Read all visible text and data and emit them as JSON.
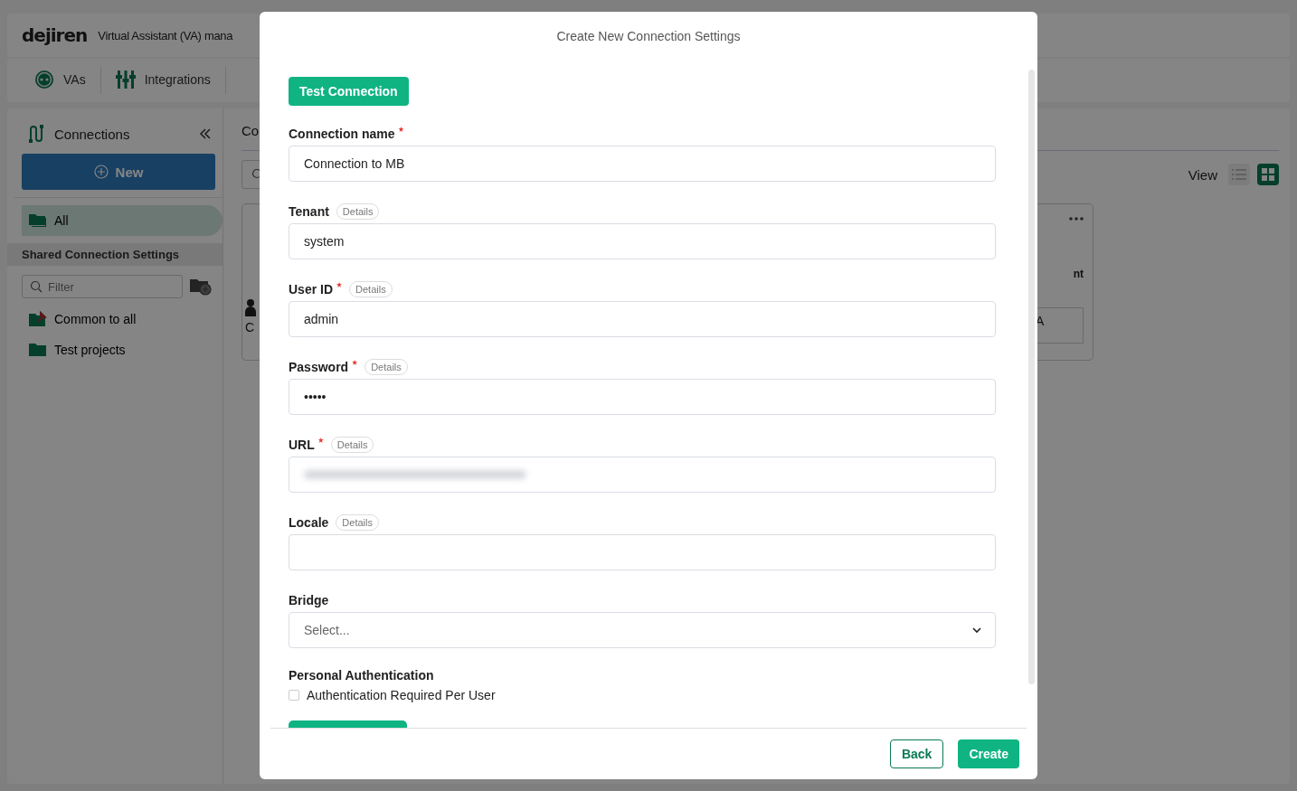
{
  "app": {
    "logo": "dejiren",
    "title": "Virtual Assistant (VA) mana",
    "tabs": [
      {
        "label": "VAs",
        "kind": "vas",
        "selected": false
      },
      {
        "label": "Integrations",
        "kind": "integrations",
        "selected": false
      }
    ],
    "sidebar": {
      "title": "Connections",
      "new_button": "New",
      "items": [
        {
          "label": "All",
          "selected": true
        }
      ],
      "section": "Shared Connection Settings",
      "filter_placeholder": "Filter",
      "folders": [
        {
          "label": "Common to all",
          "kind": "pinned"
        },
        {
          "label": "Test projects",
          "kind": "folder"
        }
      ]
    },
    "content": {
      "heading": "Co",
      "view_label": "View",
      "view_modes": [
        {
          "kind": "list",
          "selected": false
        },
        {
          "kind": "grid",
          "selected": true
        }
      ],
      "card": {
        "left_text": "C",
        "right_text": "nt",
        "right_box_text": "A"
      }
    }
  },
  "dialog": {
    "title": "Create New Connection Settings",
    "test_button": "Test Connection",
    "fields": [
      {
        "label": "Connection name",
        "required": true,
        "kind": "text",
        "value": "Connection to MB"
      },
      {
        "label": "Tenant",
        "required": false,
        "details": "Details",
        "kind": "text",
        "value": "system"
      },
      {
        "label": "User ID",
        "required": true,
        "details": "Details",
        "kind": "text",
        "value": "admin"
      },
      {
        "label": "Password",
        "required": true,
        "details": "Details",
        "kind": "text",
        "value": "•••••"
      },
      {
        "label": "URL",
        "required": true,
        "details": "Details",
        "kind": "redacted"
      },
      {
        "label": "Locale",
        "required": false,
        "details": "Details",
        "kind": "text"
      },
      {
        "label": "Bridge",
        "required": false,
        "kind": "select",
        "placeholder": "Select..."
      }
    ],
    "personal_auth": {
      "heading": "Personal Authentication",
      "label": "Authentication Required Per User",
      "checked": false
    },
    "footer": [
      {
        "label": "Back",
        "kind": "outline"
      },
      {
        "label": "Create",
        "kind": "primary"
      }
    ]
  }
}
